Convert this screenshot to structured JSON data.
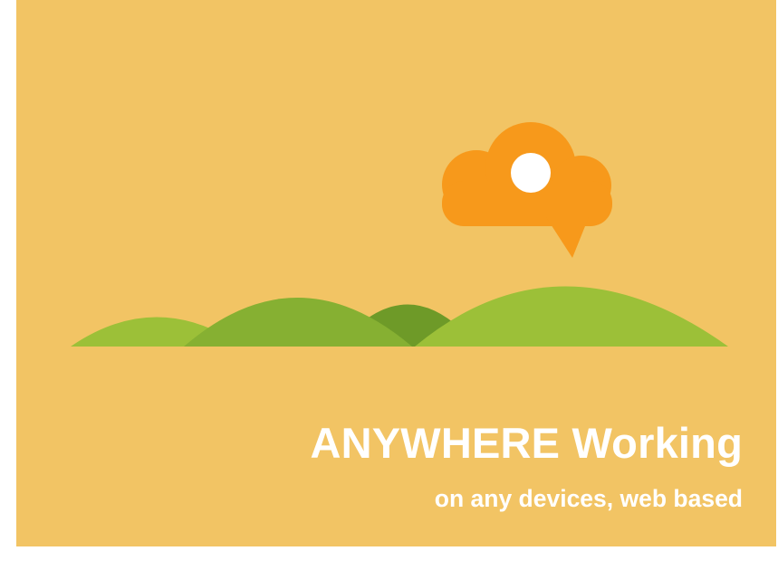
{
  "banner": {
    "headline": "ANYWHERE Working",
    "subline": "on any devices, web based"
  },
  "icons": {
    "cloud": "speech-bubble-cloud-icon",
    "sun": "sun-icon",
    "hills": "green-hills-illustration"
  },
  "colors": {
    "background": "#f2c464",
    "cloud": "#f7991b",
    "sun": "#ffffff",
    "hill_light": "#9cc038",
    "hill_mid": "#86b032",
    "hill_dark": "#6e9a28",
    "text": "#ffffff"
  }
}
